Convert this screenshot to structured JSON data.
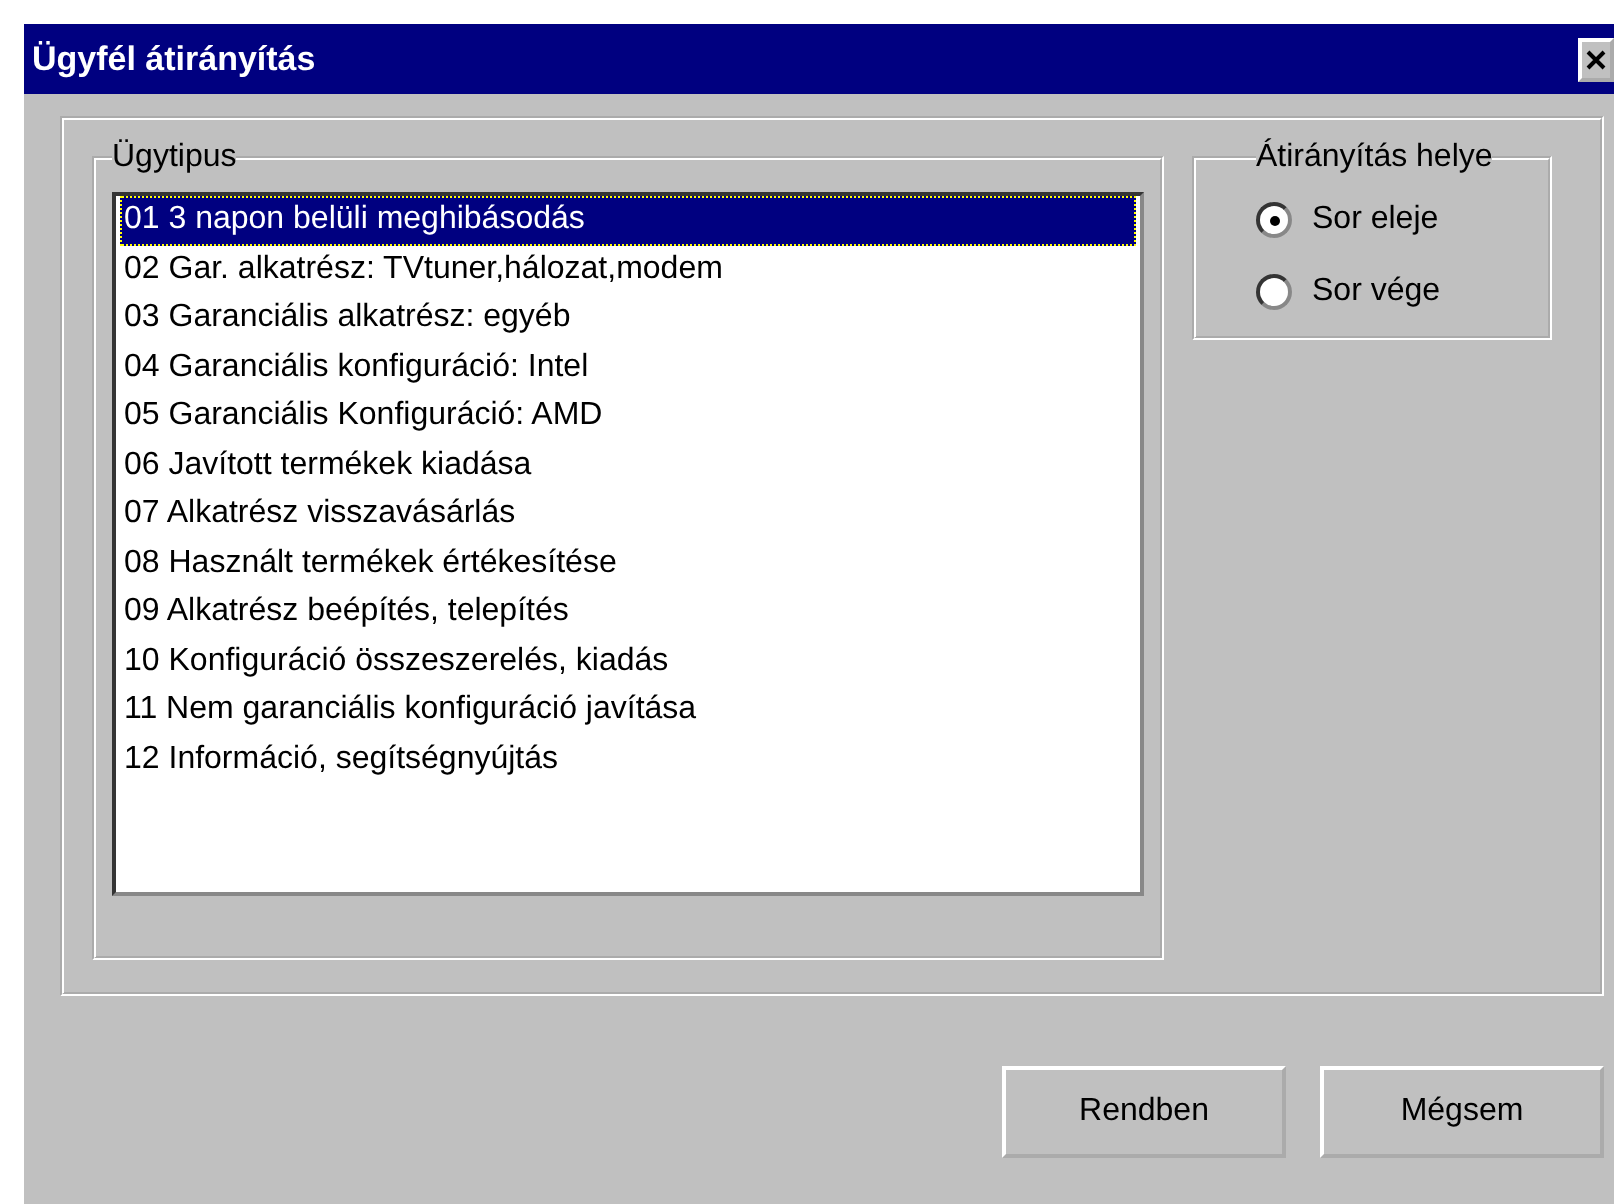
{
  "window": {
    "title": "Ügyfél átirányítás"
  },
  "case_type": {
    "label": "Ügytipus",
    "items": [
      {
        "text": "01 3 napon belüli meghibásodás",
        "selected": true
      },
      {
        "text": "02 Gar. alkatrész: TVtuner,hálozat,modem",
        "selected": false
      },
      {
        "text": "03 Garanciális alkatrész: egyéb",
        "selected": false
      },
      {
        "text": "04 Garanciális konfiguráció: Intel",
        "selected": false
      },
      {
        "text": "05 Garanciális Konfiguráció: AMD",
        "selected": false
      },
      {
        "text": "06 Javított termékek kiadása",
        "selected": false
      },
      {
        "text": "07 Alkatrész visszavásárlás",
        "selected": false
      },
      {
        "text": "08 Használt termékek értékesítése",
        "selected": false
      },
      {
        "text": "09 Alkatrész beépítés, telepítés",
        "selected": false
      },
      {
        "text": "10 Konfiguráció összeszerelés, kiadás",
        "selected": false
      },
      {
        "text": "11 Nem garanciális konfiguráció javítása",
        "selected": false
      },
      {
        "text": "12 Információ, segítségnyújtás",
        "selected": false
      }
    ]
  },
  "redirect_place": {
    "label": "Átirányítás helye",
    "options": [
      {
        "label": "Sor eleje",
        "selected": true
      },
      {
        "label": "Sor vége",
        "selected": false
      }
    ]
  },
  "buttons": [
    "Rendben",
    "Mégsem"
  ]
}
